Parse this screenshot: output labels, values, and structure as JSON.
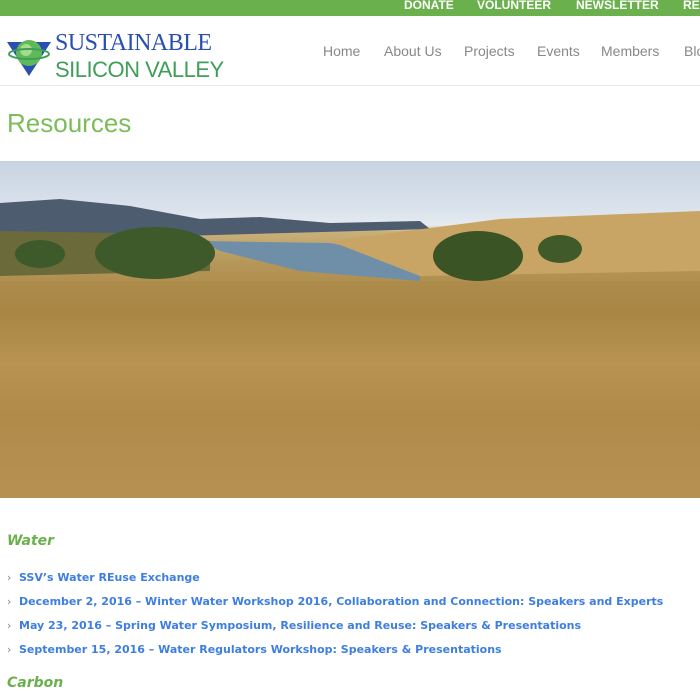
{
  "topbar": {
    "links": [
      "DONATE",
      "VOLUNTEER",
      "NEWSLETTER",
      "RE"
    ]
  },
  "logo": {
    "line1": "SUSTAINABLE",
    "line2": "SILICON VALLEY"
  },
  "nav": [
    "Home",
    "About Us",
    "Projects",
    "Events",
    "Members",
    "Blo"
  ],
  "page_title": "Resources",
  "sections": [
    {
      "heading": "Water",
      "items": [
        "SSV’s Water REuse Exchange",
        "December 2, 2016 – Winter Water Workshop 2016, Collaboration and Connection: Speakers and Experts",
        "May 23, 2016 – Spring Water Symposium, Resilience and Reuse: Speakers & Presentations",
        "September 15, 2016 – Water Regulators Workshop: Speakers & Presentations"
      ]
    },
    {
      "heading": "Carbon",
      "items": []
    }
  ],
  "colors": {
    "brand_green": "#6ab04c",
    "link_blue": "#3d7ee0"
  }
}
